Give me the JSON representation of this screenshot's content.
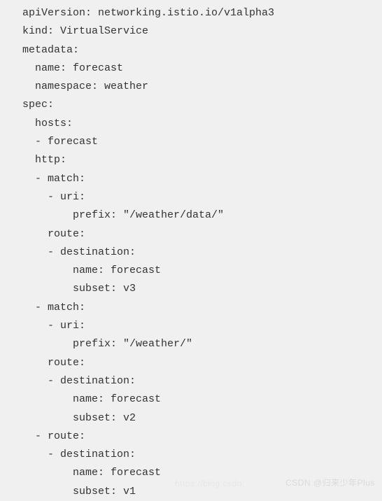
{
  "code": {
    "lines": [
      "apiVersion: networking.istio.io/v1alpha3",
      "kind: VirtualService",
      "metadata:",
      "  name: forecast",
      "  namespace: weather",
      "spec:",
      "  hosts:",
      "  - forecast",
      "  http:",
      "  - match:",
      "    - uri:",
      "        prefix: \"/weather/data/\"",
      "    route:",
      "    - destination:",
      "        name: forecast",
      "        subset: v3",
      "  - match:",
      "    - uri:",
      "        prefix: \"/weather/\"",
      "    route:",
      "    - destination:",
      "        name: forecast",
      "        subset: v2",
      "  - route:",
      "    - destination:",
      "        name: forecast",
      "        subset: v1"
    ]
  },
  "watermark": {
    "left": "https://blog.csdn",
    "right": "CSDN @归来少年Plus"
  }
}
